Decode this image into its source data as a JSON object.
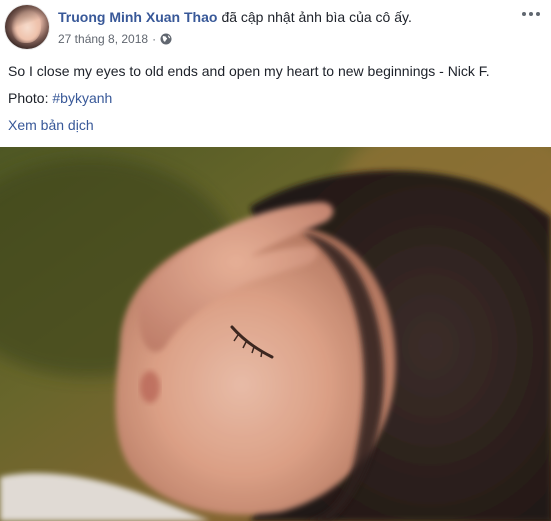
{
  "post": {
    "author": "Truong Minh Xuan Thao",
    "action": "đã cập nhật ảnh bìa của cô ấy.",
    "timestamp": "27 tháng 8, 2018",
    "separator": "·",
    "privacy_icon": "globe-icon",
    "more_icon": "more-options-icon",
    "text_line_1": "So I close my eyes to old ends and open my heart to new beginnings - Nick F.",
    "photo_label": "Photo: ",
    "hashtag": "#bykyanh",
    "translate_label": "Xem bản dịch"
  },
  "colors": {
    "link": "#385898",
    "text": "#1d2129",
    "meta": "#616770"
  }
}
